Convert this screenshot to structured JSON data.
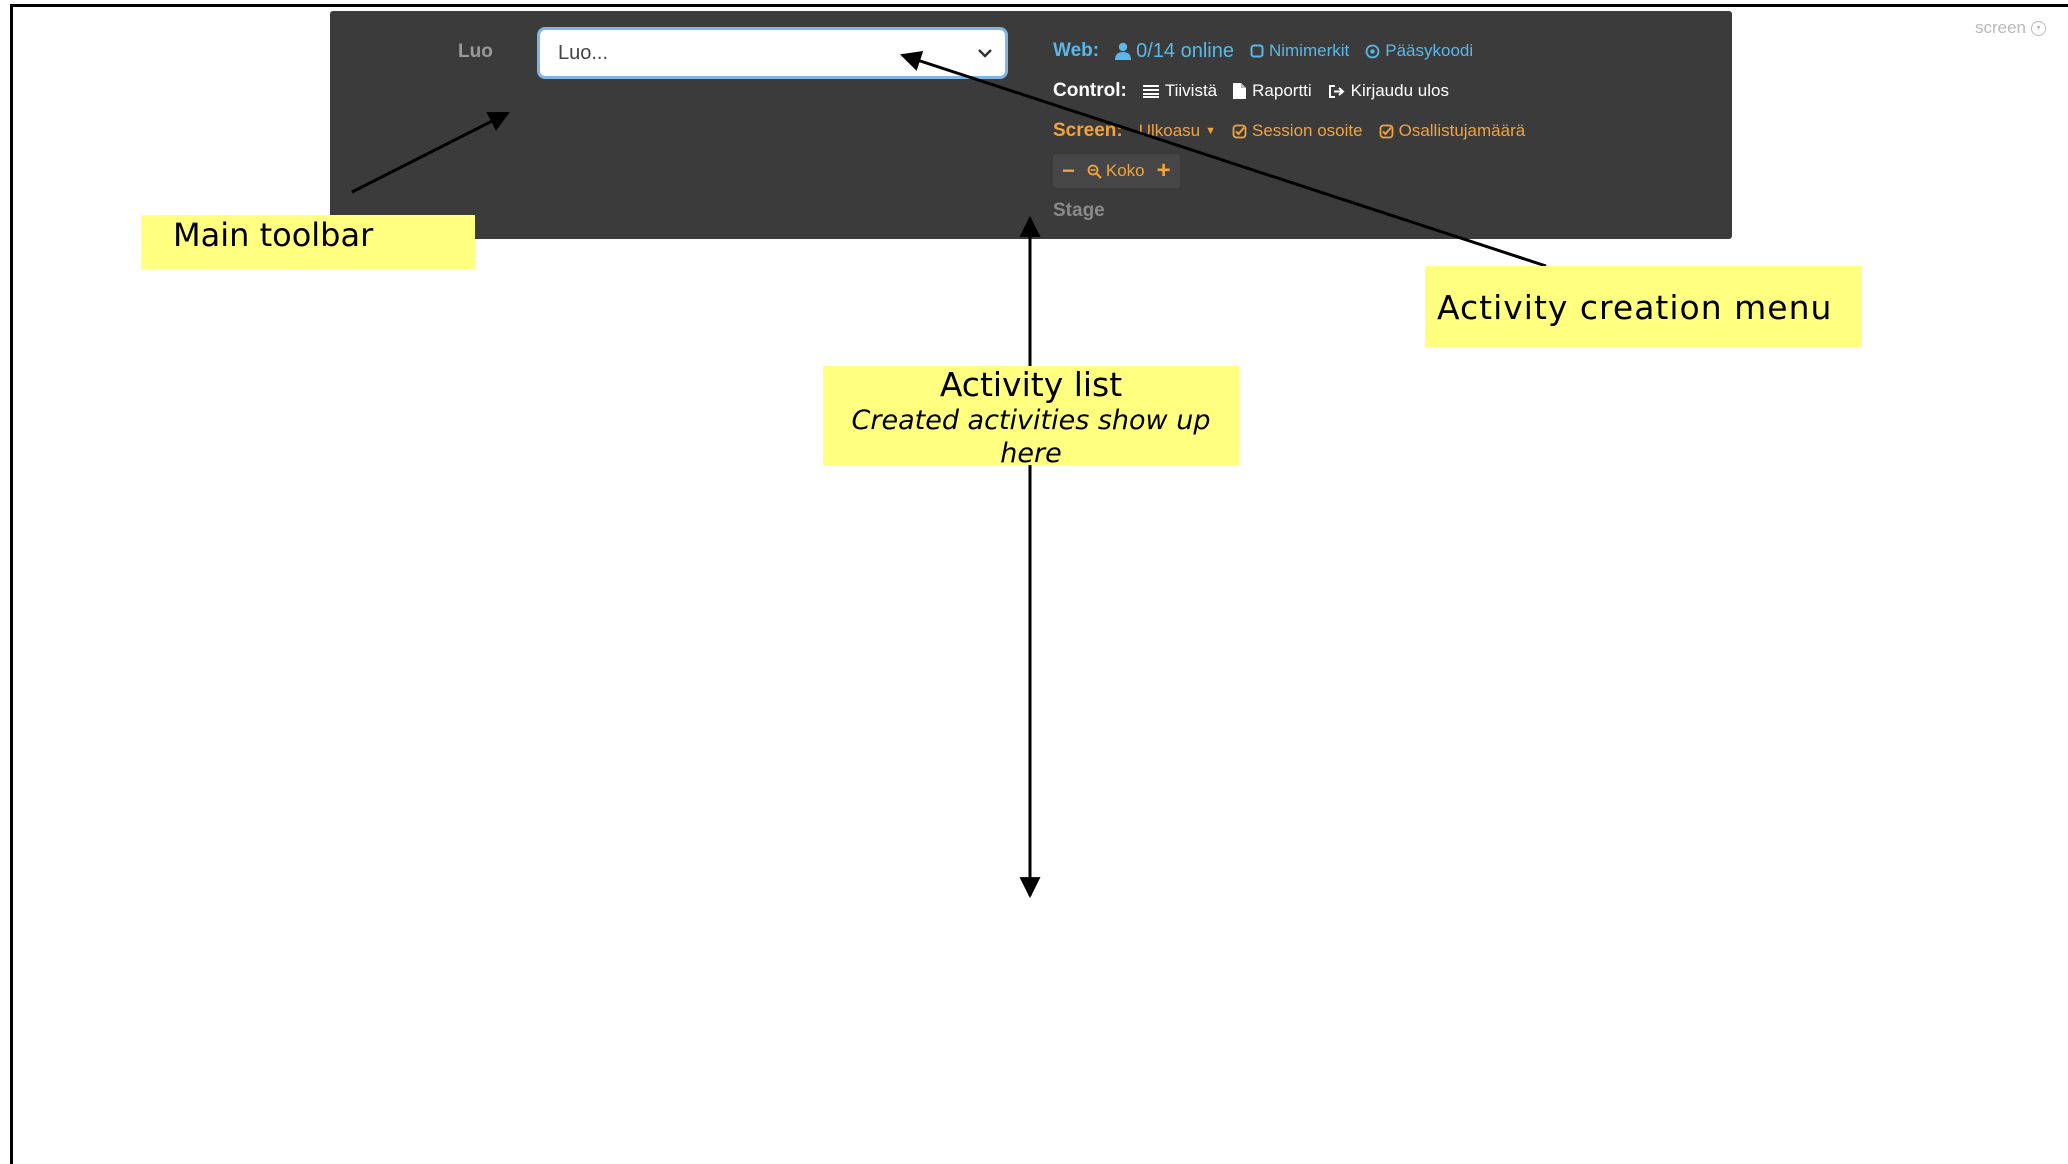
{
  "screen_toggle": {
    "label": "screen"
  },
  "toolbar": {
    "create_label": "Luo",
    "create_select": {
      "value": "Luo..."
    },
    "web": {
      "label": "Web:",
      "online": "0/14 online",
      "nicknames": "Nimimerkit",
      "access_code": "Pääsykoodi"
    },
    "control": {
      "label": "Control:",
      "compact": "Tiivistä",
      "report": "Raportti",
      "logout": "Kirjaudu ulos"
    },
    "screen": {
      "label": "Screen:",
      "layout": "Ulkoasu",
      "session_address": "Session osoite",
      "participant_count": "Osallistujamäärä"
    },
    "zoom": {
      "label": "Koko"
    },
    "stage": {
      "label": "Stage"
    }
  },
  "annotations": {
    "main_toolbar": "Main toolbar",
    "activity_creation_menu": "Activity creation menu",
    "activity_list_title": "Activity list",
    "activity_list_subtitle": "Created activities show up here"
  },
  "colors": {
    "toolbar_bg": "#3b3b3b",
    "web_accent": "#5ab8e8",
    "screen_accent": "#f0a33e",
    "annotation_bg": "#ffff80"
  }
}
